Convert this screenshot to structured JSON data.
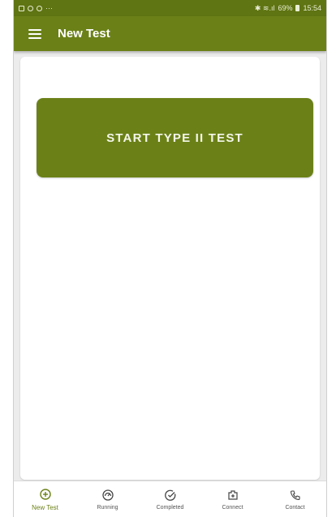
{
  "status_bar": {
    "left_extra": "···",
    "signal_text": "✱ ≋.ıl",
    "battery": "69%",
    "time": "15:54"
  },
  "app_bar": {
    "title": "New Test",
    "menu_icon": "hamburger-menu-icon"
  },
  "main": {
    "start_button_label": "START TYPE II TEST"
  },
  "bottom_nav": {
    "items": [
      {
        "label": "New Test",
        "icon": "plus-circle-icon",
        "active": true
      },
      {
        "label": "Running",
        "icon": "gauge-icon",
        "active": false
      },
      {
        "label": "Completed",
        "icon": "check-circle-icon",
        "active": false
      },
      {
        "label": "Connect",
        "icon": "connect-icon",
        "active": false
      },
      {
        "label": "Contact",
        "icon": "phone-icon",
        "active": false
      }
    ]
  },
  "colors": {
    "primary": "#6b8118",
    "status_bar": "#5f7412",
    "background": "#ececec"
  }
}
